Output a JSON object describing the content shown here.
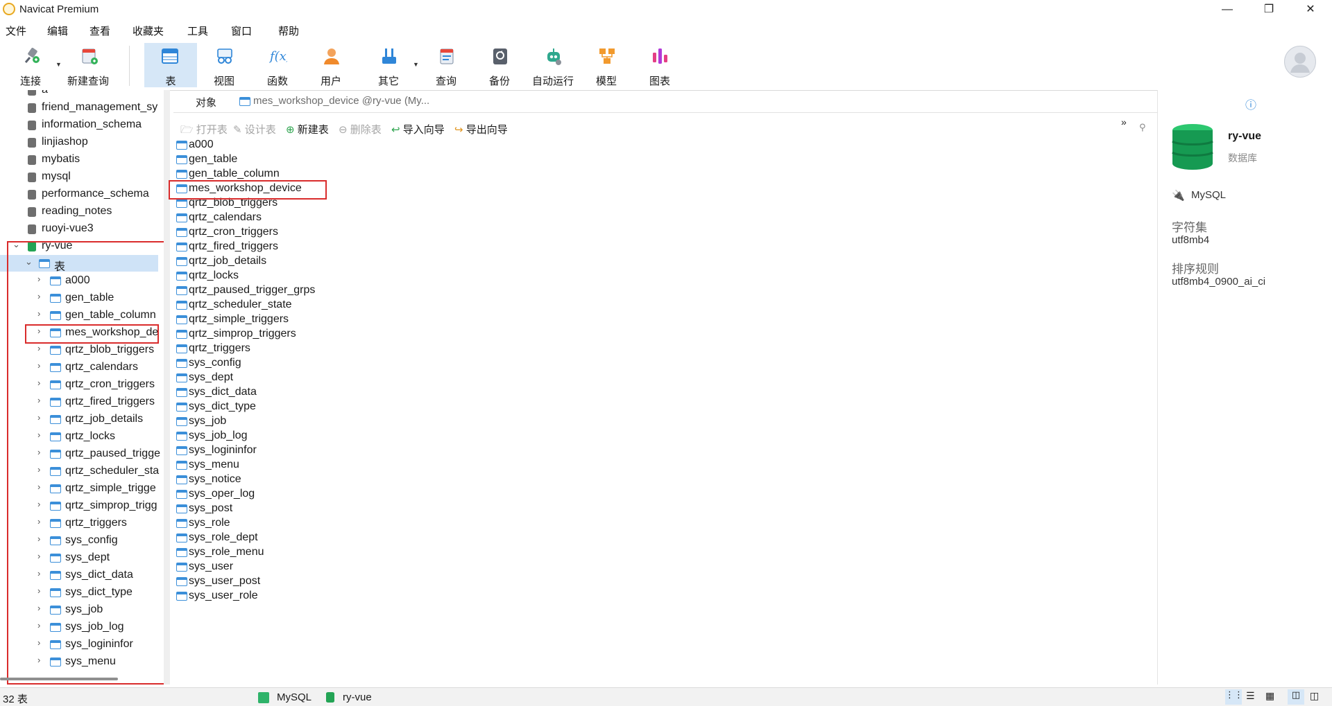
{
  "window": {
    "title": "Navicat Premium"
  },
  "menu": [
    "文件",
    "编辑",
    "查看",
    "收藏夹",
    "工具",
    "窗口",
    "帮助"
  ],
  "toolbar": {
    "connect": "连接",
    "new_query": "新建查询",
    "table": "表",
    "view": "视图",
    "function": "函数",
    "user": "用户",
    "other": "其它",
    "query": "查询",
    "backup": "备份",
    "automation": "自动运行",
    "model": "模型",
    "chart": "图表"
  },
  "sidebar": {
    "databases": [
      "a",
      "friend_management_sy",
      "information_schema",
      "linjiashop",
      "mybatis",
      "mysql",
      "performance_schema",
      "reading_notes",
      "ruoyi-vue3"
    ],
    "active_db": "ry-vue",
    "tables_node": "表",
    "tables": [
      "a000",
      "gen_table",
      "gen_table_column",
      "mes_workshop_de",
      "qrtz_blob_triggers",
      "qrtz_calendars",
      "qrtz_cron_triggers",
      "qrtz_fired_triggers",
      "qrtz_job_details",
      "qrtz_locks",
      "qrtz_paused_trigge",
      "qrtz_scheduler_sta",
      "qrtz_simple_trigge",
      "qrtz_simprop_trigg",
      "qrtz_triggers",
      "sys_config",
      "sys_dept",
      "sys_dict_data",
      "sys_dict_type",
      "sys_job",
      "sys_job_log",
      "sys_logininfor",
      "sys_menu"
    ]
  },
  "tabs": {
    "objects": "对象",
    "editor": "mes_workshop_device @ry-vue (My..."
  },
  "object_toolbar": {
    "open": "打开表",
    "design": "设计表",
    "new": "新建表",
    "delete": "删除表",
    "import": "导入向导",
    "export": "导出向导"
  },
  "objects": [
    "a000",
    "gen_table",
    "gen_table_column",
    "mes_workshop_device",
    "qrtz_blob_triggers",
    "qrtz_calendars",
    "qrtz_cron_triggers",
    "qrtz_fired_triggers",
    "qrtz_job_details",
    "qrtz_locks",
    "qrtz_paused_trigger_grps",
    "qrtz_scheduler_state",
    "qrtz_simple_triggers",
    "qrtz_simprop_triggers",
    "qrtz_triggers",
    "sys_config",
    "sys_dept",
    "sys_dict_data",
    "sys_dict_type",
    "sys_job",
    "sys_job_log",
    "sys_logininfor",
    "sys_menu",
    "sys_notice",
    "sys_oper_log",
    "sys_post",
    "sys_role",
    "sys_role_dept",
    "sys_role_menu",
    "sys_user",
    "sys_user_post",
    "sys_user_role"
  ],
  "info_panel": {
    "name": "ry-vue",
    "type": "数据库",
    "server": "MySQL",
    "charset_label": "字符集",
    "charset": "utf8mb4",
    "collation_label": "排序规则",
    "collation": "utf8mb4_0900_ai_ci"
  },
  "status": {
    "count": "32 表",
    "connection": "MySQL",
    "database": "ry-vue"
  }
}
